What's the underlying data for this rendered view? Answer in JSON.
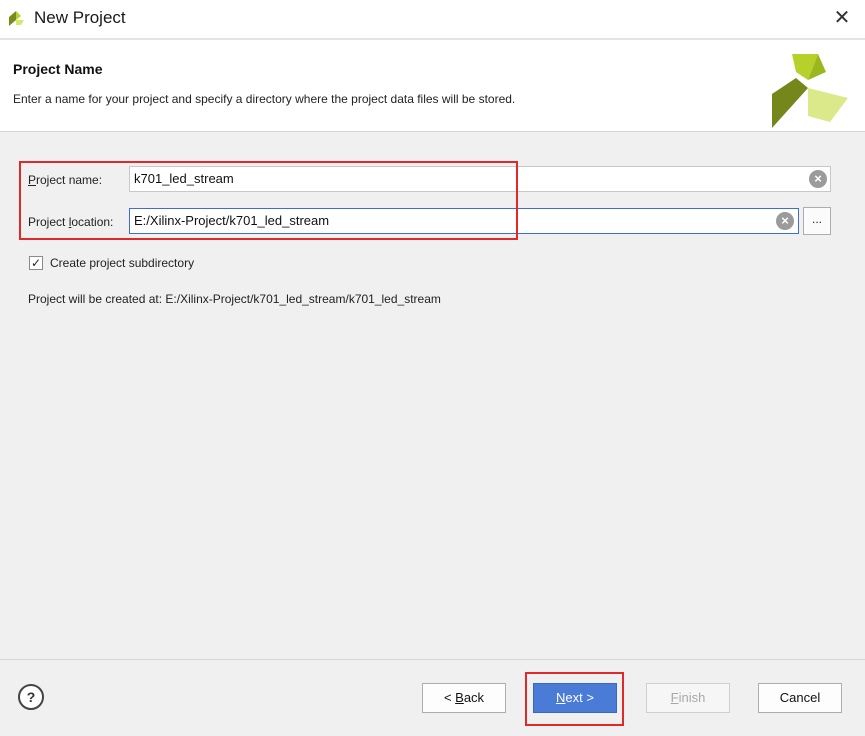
{
  "window": {
    "title": "New Project",
    "close_glyph": "✕"
  },
  "header": {
    "title": "Project Name",
    "description": "Enter a name for your project and specify a directory where the project data files will be stored."
  },
  "form": {
    "name_label_prefix": "P",
    "name_label_rest": "roject name:",
    "name_value": "k701_led_stream",
    "location_label_prefix": "Project ",
    "location_label_mnemonic": "l",
    "location_label_rest": "ocation:",
    "location_value": "E:/Xilinx-Project/k701_led_stream",
    "browse_label": "...",
    "subdir_label": "Create project subdirectory",
    "subdir_checked": true,
    "created_at_text": "Project will be created at: E:/Xilinx-Project/k701_led_stream/k701_led_stream"
  },
  "footer": {
    "help_label": "?",
    "back_label_prefix": "< ",
    "back_label_mnemonic": "B",
    "back_label_rest": "ack",
    "next_label_mnemonic": "N",
    "next_label_rest": "ext >",
    "finish_label_mnemonic": "F",
    "finish_label_rest": "inish",
    "cancel_label": "Cancel"
  },
  "colors": {
    "accent": "#4a7bd6",
    "highlight": "#e02a2a",
    "logo_green": "#a8c324",
    "logo_olive": "#6e7d14"
  },
  "icons": {
    "app": "xilinx-logo-icon",
    "clear": "clear-circle-icon",
    "check": "checkmark-icon"
  }
}
